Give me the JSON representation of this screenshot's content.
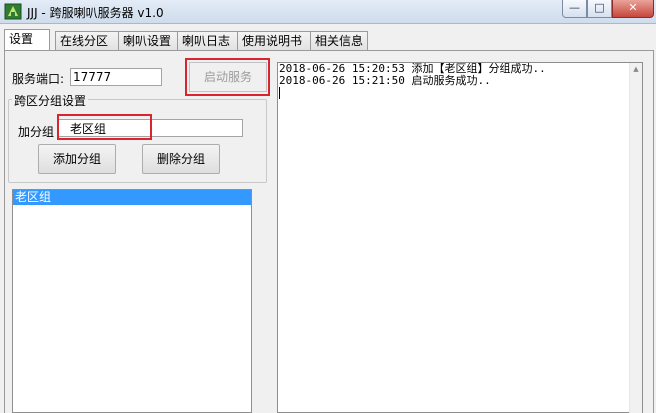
{
  "window": {
    "title": "JJJ - 跨服喇叭服务器 v1.0",
    "icon": "app-icon",
    "buttons": {
      "minimize": "—",
      "maximize": "□",
      "close": "✕"
    }
  },
  "tabs": [
    {
      "label": "设置",
      "active": true
    },
    {
      "label": "在线分区",
      "active": false
    },
    {
      "label": "喇叭设置",
      "active": false
    },
    {
      "label": "喇叭日志",
      "active": false
    },
    {
      "label": "使用说明书",
      "active": false
    },
    {
      "label": "相关信息",
      "active": false
    }
  ],
  "settings": {
    "port_label": "服务端口:",
    "port_value": "17777",
    "start_button": "启动服务",
    "group_section_title": "跨区分组设置",
    "add_group_label": "加分组",
    "add_group_value": "老区组",
    "add_group_button": "添加分组",
    "delete_group_button": "删除分组",
    "group_list": [
      "老区组"
    ]
  },
  "log": {
    "lines": [
      "2018-06-26 15:20:53 添加【老区组】分组成功..",
      "2018-06-26 15:21:50 启动服务成功.."
    ]
  },
  "colors": {
    "highlight": "#d9262e",
    "selection": "#3399ff"
  }
}
